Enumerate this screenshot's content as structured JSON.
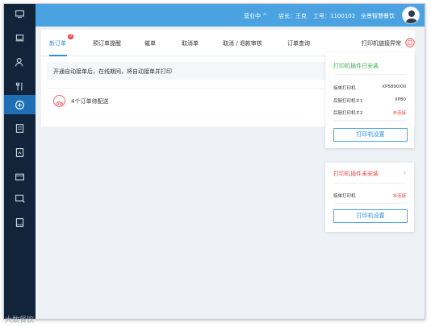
{
  "topbar": {
    "status": "营业中",
    "manager": "店长：王克",
    "employee_id": "工号：1100102",
    "store_name": "全景智慧餐饮"
  },
  "tabs": [
    {
      "label": "新订单",
      "active": true,
      "badge": "3"
    },
    {
      "label": "预订单提醒"
    },
    {
      "label": "催单"
    },
    {
      "label": "取消单"
    },
    {
      "label": "取消 / 退款审核"
    },
    {
      "label": "订单查询"
    }
  ],
  "printer_link": {
    "label": "打印机链接异常"
  },
  "notice": "开通自动接单后，在线期间，将自动接单并打印",
  "pending_orders": "4个订单待配送",
  "installed_card": {
    "title": "打印机插件已安装",
    "title_color": "#3bb34a",
    "rows": [
      {
        "name": "接单打印机",
        "value": "XP5890XIII",
        "status": "ok"
      },
      {
        "name": "后厨打印机＃1",
        "value": "XP80",
        "status": "ok"
      },
      {
        "name": "后厨打印机＃2",
        "value": "未连接",
        "status": "error"
      }
    ],
    "button": "打印机设置"
  },
  "not_installed_card": {
    "title": "打印机插件未安装",
    "title_color": "#f04a4a",
    "rows": [
      {
        "name": "接单打印机",
        "value": "未连接",
        "status": "error"
      }
    ],
    "button": "打印机设置"
  },
  "sidebar_icons": [
    "monitor-icon",
    "desk-icon",
    "user-settings-icon",
    "fork-knife-icon",
    "order-icon",
    "list-icon",
    "report-icon",
    "card-icon",
    "coupon-icon",
    "book-icon"
  ],
  "watermark": "大数餐饮"
}
